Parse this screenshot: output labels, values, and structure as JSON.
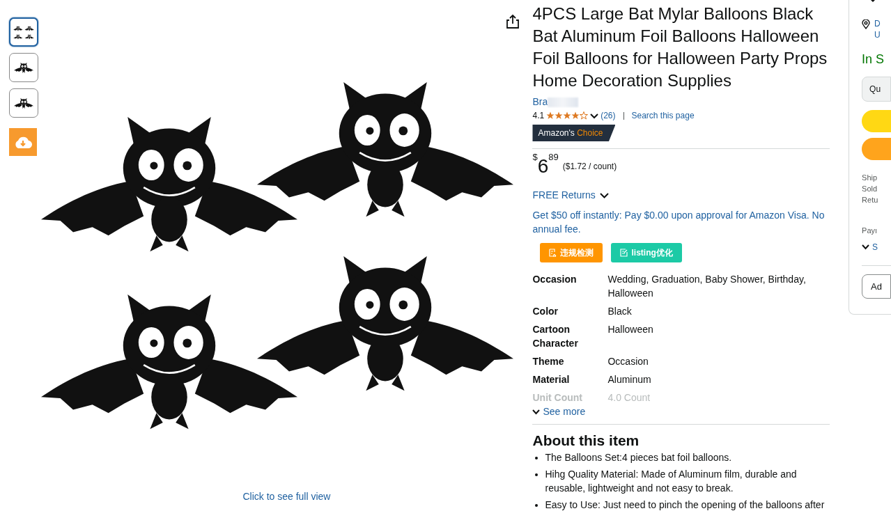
{
  "thumbnails": [
    {
      "selected": true
    },
    {
      "selected": false
    },
    {
      "selected": false
    }
  ],
  "image": {
    "caption": "Click to see full view"
  },
  "product": {
    "title": "4PCS Large Bat Mylar Balloons Black Bat Aluminum Foil Balloons Halloween Foil Balloons for Halloween Party Props Home Decoration Supplies",
    "brand": "Bra",
    "rating": "4.1",
    "stars": 4,
    "reviews": "(26)",
    "search_link": "Search this page",
    "badge": {
      "prefix": "Amazon's",
      "suffix": "Choice"
    },
    "price": {
      "currency": "$",
      "whole": "6",
      "fraction": "89",
      "unit": "($1.72 / count)"
    },
    "returns": "FREE Returns",
    "offer": "Get $50 off instantly: Pay $0.00 upon approval for Amazon Visa. No annual fee.",
    "tools": [
      {
        "kind": "check",
        "label": "违规检测"
      },
      {
        "kind": "optimize",
        "label": "listing优化"
      }
    ],
    "specs": [
      {
        "label": "Occasion",
        "value": "Wedding, Graduation, Baby Shower, Birthday, Halloween",
        "faded": false
      },
      {
        "label": "Color",
        "value": "Black",
        "faded": false
      },
      {
        "label": "Cartoon Character",
        "value": "Halloween",
        "faded": false
      },
      {
        "label": "Theme",
        "value": "Occasion",
        "faded": false
      },
      {
        "label": "Material",
        "value": "Aluminum",
        "faded": false
      },
      {
        "label": "Unit Count",
        "value": "4.0 Count",
        "faded": true
      }
    ],
    "see_more": "See more",
    "about": {
      "heading": "About this item",
      "bullets": [
        "The Balloons Set:4 pieces bat foil balloons.",
        "Hihg Quality Material: Made of Aluminum film, durable and reusable, lightweight and not easy to break.",
        "Easy to Use: Just need to pinch the opening of the balloons after"
      ]
    }
  },
  "buy_box": {
    "location": [
      "D",
      "U"
    ],
    "stock": "In S",
    "quantity": "Qu",
    "info": [
      "Ship",
      "Sold",
      "Retu"
    ],
    "payment": "Payı",
    "see": "S",
    "add": "Ad"
  }
}
